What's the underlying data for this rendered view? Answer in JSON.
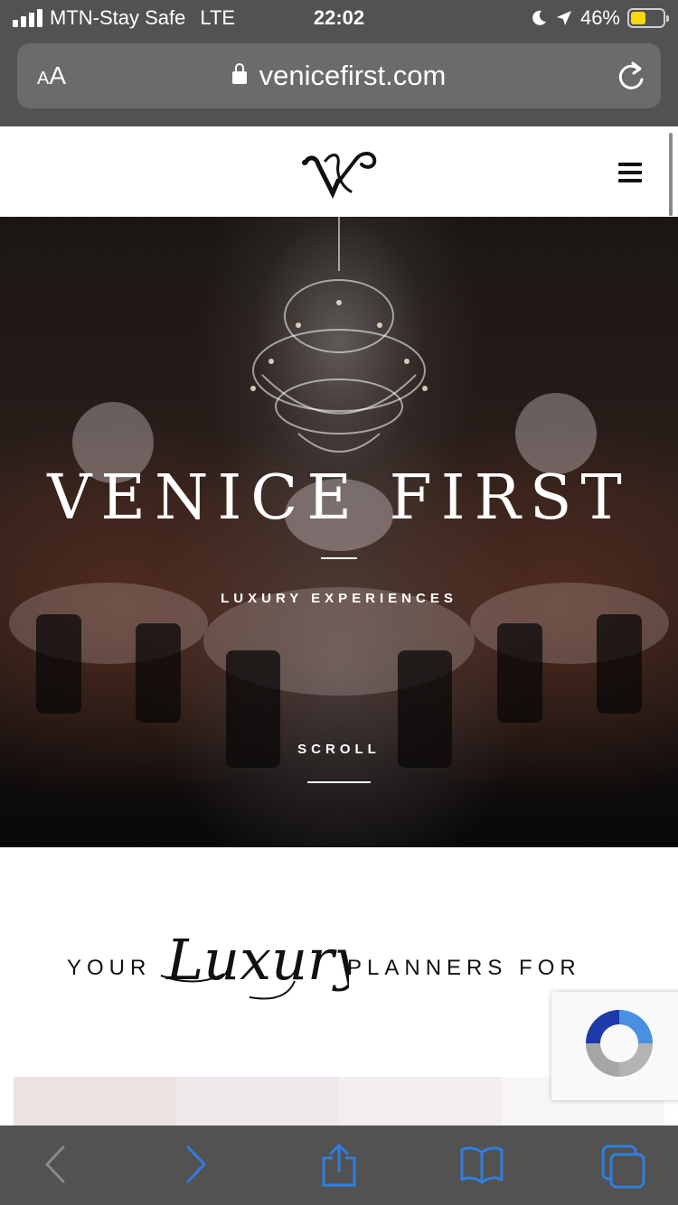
{
  "status_bar": {
    "carrier": "MTN-Stay Safe",
    "network": "LTE",
    "time": "22:02",
    "battery": "46%",
    "battery_level": 0.46
  },
  "browser": {
    "text_size_button": "AA",
    "url": "venicefirst.com"
  },
  "hero": {
    "title": "VENICE FIRST",
    "subtitle": "LUXURY EXPERIENCES",
    "scroll_label": "SCROLL"
  },
  "intro": {
    "left_text": "YOUR",
    "script_text": "Luxury",
    "right_text": "PLANNERS FOR"
  },
  "colors": {
    "chrome": "#525252",
    "url_bar": "#6b6b6b",
    "battery": "#ffd60a",
    "accent": "#2f7fe0",
    "disabled": "#8a8a8a"
  },
  "tiles": [
    "#ebe3e2",
    "#eee8e8",
    "#f2eeee",
    "#f7f5f5"
  ]
}
